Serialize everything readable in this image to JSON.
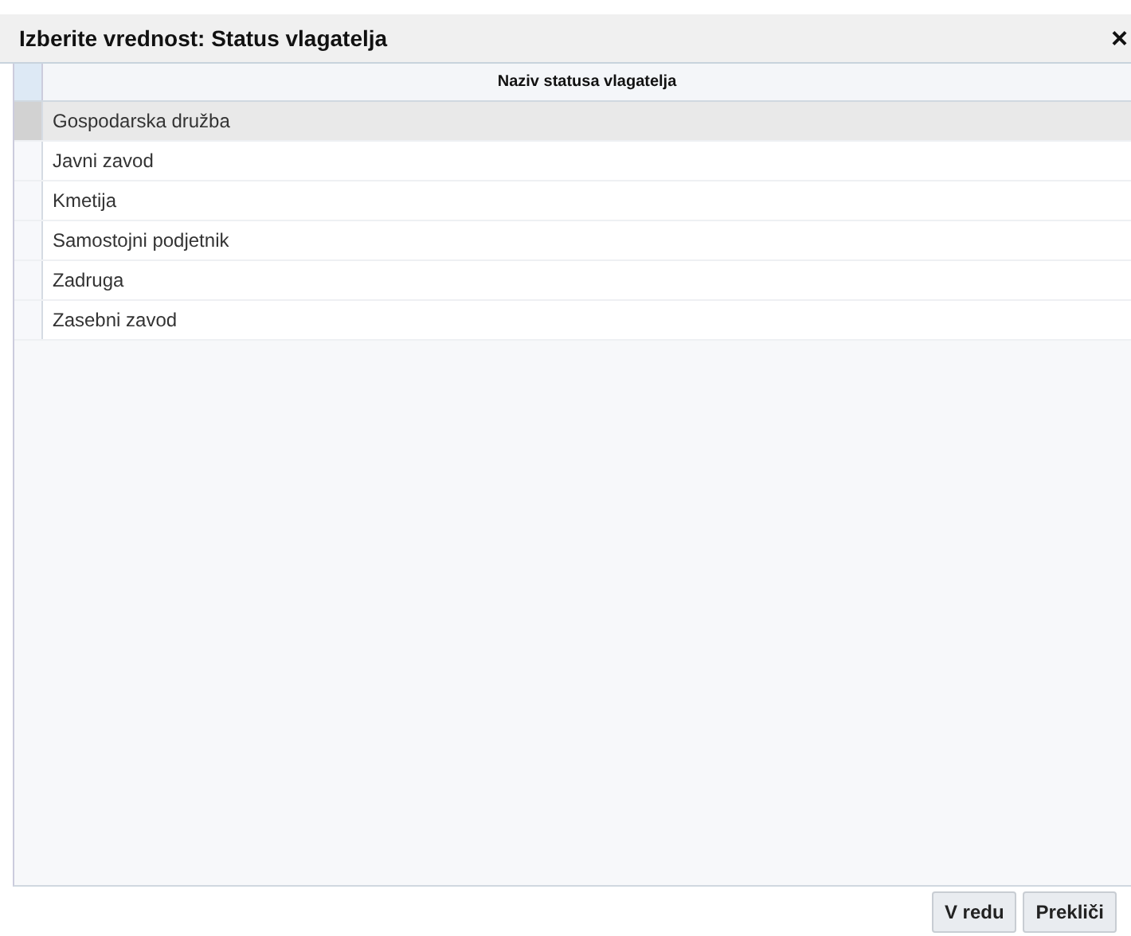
{
  "window": {
    "title": "Izberite vrednost: Status vlagatelja",
    "close": "×"
  },
  "table": {
    "columns": [
      "Naziv statusa vlagatelja"
    ],
    "rows": [
      {
        "name": "Gospodarska družba",
        "selected": true
      },
      {
        "name": "Javni zavod",
        "selected": false
      },
      {
        "name": "Kmetija",
        "selected": false
      },
      {
        "name": "Samostojni podjetnik",
        "selected": false
      },
      {
        "name": "Zadruga",
        "selected": false
      },
      {
        "name": "Zasebni zavod",
        "selected": false
      }
    ]
  },
  "buttons": [
    "V redu",
    "Prekliči"
  ]
}
